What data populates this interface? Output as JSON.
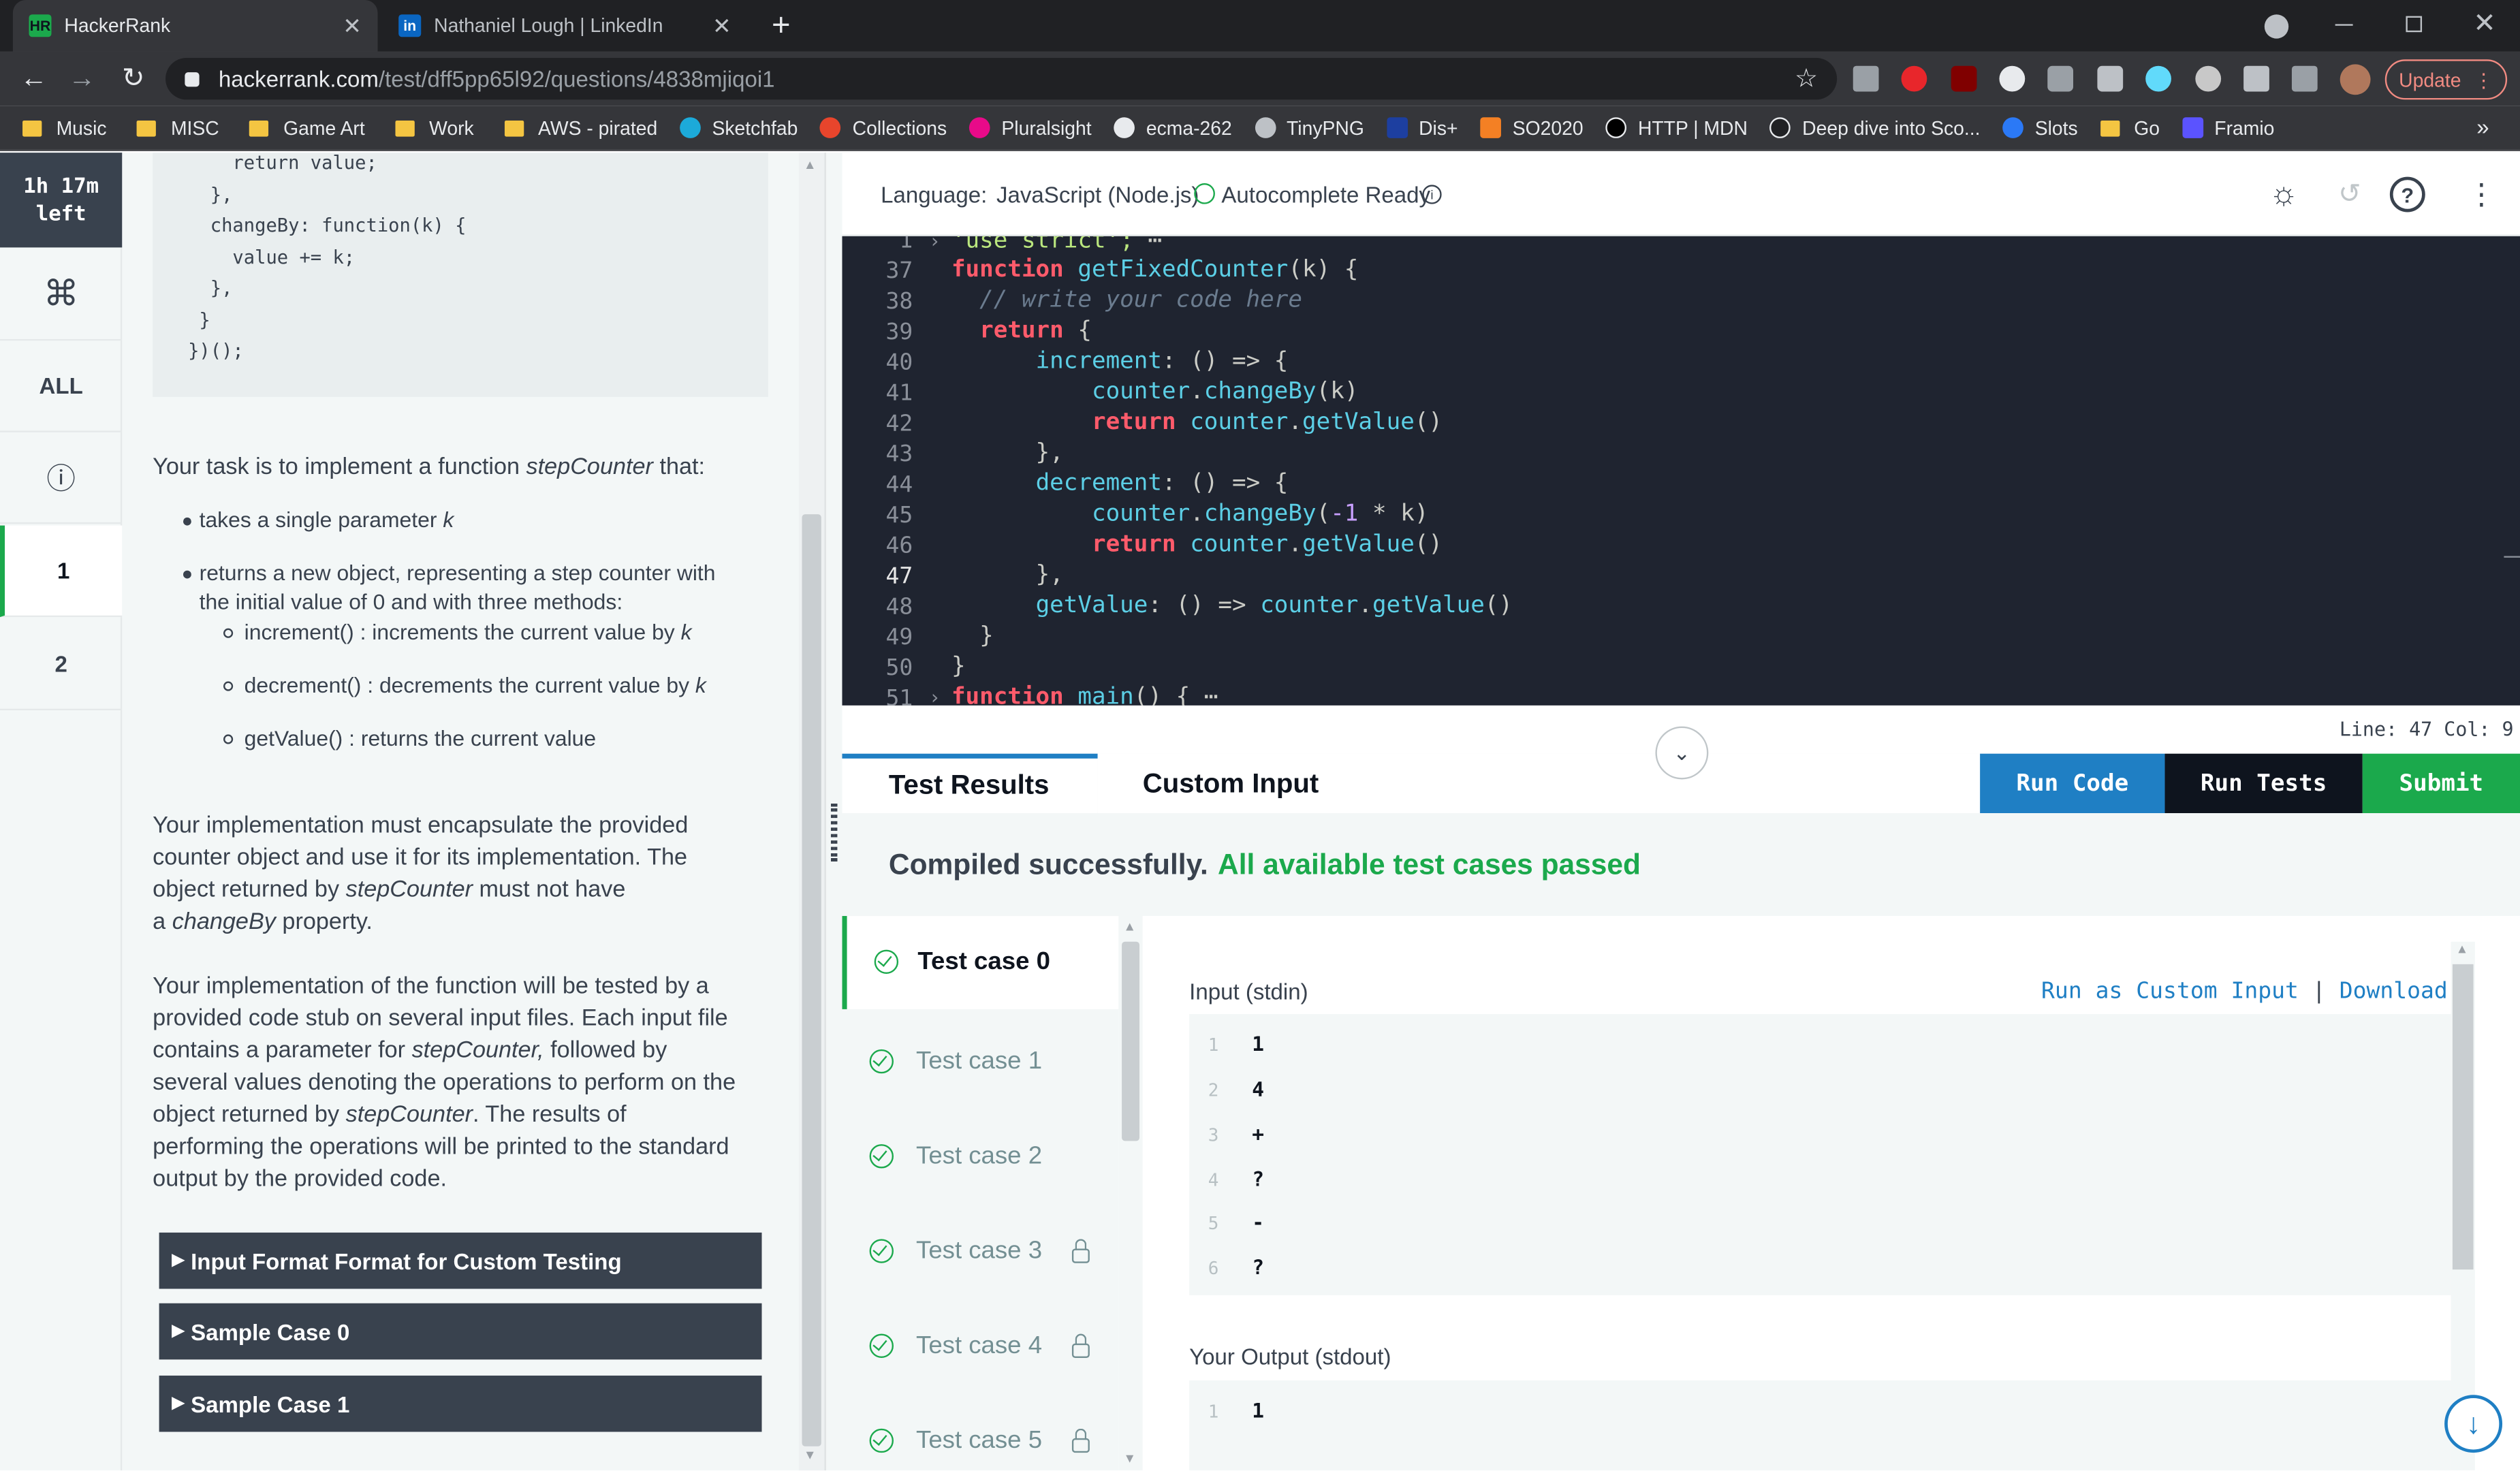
{
  "browser": {
    "tabs": [
      {
        "title": "HackerRank",
        "active": true,
        "favicon": "HR"
      },
      {
        "title": "Nathaniel Lough | LinkedIn",
        "active": false,
        "favicon": "in"
      }
    ],
    "url_host": "hackerrank.com",
    "url_path": "/test/dff5pp65l92/questions/4838mjiqoi1",
    "update_label": "Update",
    "bookmarks": [
      {
        "label": "Music",
        "icon": "folder"
      },
      {
        "label": "MISC",
        "icon": "folder"
      },
      {
        "label": "Game Art",
        "icon": "folder"
      },
      {
        "label": "Work",
        "icon": "folder"
      },
      {
        "label": "AWS  - pirated",
        "icon": "folder"
      },
      {
        "label": "Sketchfab",
        "icon": "sketchfab"
      },
      {
        "label": "Collections",
        "icon": "collections"
      },
      {
        "label": "Pluralsight",
        "icon": "pluralsight"
      },
      {
        "label": "ecma-262",
        "icon": "globe"
      },
      {
        "label": "TinyPNG",
        "icon": "panda"
      },
      {
        "label": "Dis+",
        "icon": "disney"
      },
      {
        "label": "SO2020",
        "icon": "stackoverflow"
      },
      {
        "label": "HTTP | MDN",
        "icon": "mdn"
      },
      {
        "label": "Deep dive into Sco...",
        "icon": "deepdive"
      },
      {
        "label": "Slots",
        "icon": "parking"
      },
      {
        "label": "Go",
        "icon": "folder"
      },
      {
        "label": "Framio",
        "icon": "framio"
      }
    ],
    "more_bookmarks": "»"
  },
  "nav": {
    "timer_line1": "1h 17m",
    "timer_line2": "left",
    "cmd_glyph": "⌘",
    "all_label": "ALL",
    "info_glyph": "ⓘ",
    "q1": "1",
    "q2": "2"
  },
  "problem": {
    "code_lines": [
      "    return value;",
      "  },",
      "  changeBy: function(k) {",
      "    value += k;",
      "  },",
      " }",
      "})();"
    ],
    "task_intro_a": "Your task is to implement a function ",
    "task_fn": "stepCounter",
    "task_intro_b": " that:",
    "bullet1_a": "takes a single parameter ",
    "bullet1_k": "k",
    "bullet2_line1": "returns a new object, representing a step counter with",
    "bullet2_line2": "the initial value of 0 and with three methods:",
    "sub1_a": "increment() : increments the current value by ",
    "sub1_k": "k",
    "sub2_a": "decrement() : decrements the current value by ",
    "sub2_k": "k",
    "sub3": "getValue() : returns the current value",
    "para2_l1": "Your implementation must encapsulate the provided",
    "para2_l2": "counter object and use it for its implementation. The",
    "para2_l3a": "object returned by ",
    "para2_l3fn": "stepCounter",
    "para2_l3b": " must not have",
    "para2_l4a": "a ",
    "para2_l4fn": "changeBy",
    "para2_l4b": " property.",
    "para3_l1": "Your implementation of the function will be tested by a",
    "para3_l2": "provided code stub on several input files. Each input file",
    "para3_l3a": "contains a parameter for ",
    "para3_l3fn": "stepCounter,",
    "para3_l3b": " followed by",
    "para3_l4": "several values denoting the operations to perform on the",
    "para3_l5a": "object returned by ",
    "para3_l5fn": "stepCounter",
    "para3_l5b": ". The results of",
    "para3_l6": "performing the operations will be printed to the standard",
    "para3_l7": "output by the provided code.",
    "accordions": [
      "Input Format Format for Custom Testing",
      "Sample Case 0",
      "Sample Case 1"
    ]
  },
  "editor": {
    "language_label": "Language:",
    "language_value": "JavaScript (Node.js)",
    "autocomplete": "Autocomplete Ready",
    "status": "Line: 47 Col: 9",
    "line_numbers": [
      "1",
      "37",
      "38",
      "39",
      "40",
      "41",
      "42",
      "43",
      "44",
      "45",
      "46",
      "47",
      "48",
      "49",
      "50",
      "51"
    ]
  },
  "results": {
    "tab_results": "Test Results",
    "tab_custom": "Custom Input",
    "run_code": "Run Code",
    "run_tests": "Run Tests",
    "submit": "Submit",
    "compiled": "Compiled successfully.",
    "passed": "All available test cases passed",
    "cases": [
      {
        "label": "Test case 0",
        "locked": false
      },
      {
        "label": "Test case 1",
        "locked": false
      },
      {
        "label": "Test case 2",
        "locked": false
      },
      {
        "label": "Test case 3",
        "locked": true
      },
      {
        "label": "Test case 4",
        "locked": true
      },
      {
        "label": "Test case 5",
        "locked": true
      }
    ],
    "input_label": "Input (stdin)",
    "run_as_custom": "Run as Custom Input",
    "separator": "|",
    "download": "Download",
    "input_lines": [
      "1",
      "4",
      "+",
      "?",
      "-",
      "?"
    ],
    "output_label": "Your Output (stdout)",
    "output_lines": [
      "1"
    ]
  },
  "colors": {
    "accent_green": "#1ba94c",
    "run_code_blue": "#1f7fc4",
    "run_tests_black": "#0e141e",
    "dark_slate": "#39424e"
  }
}
